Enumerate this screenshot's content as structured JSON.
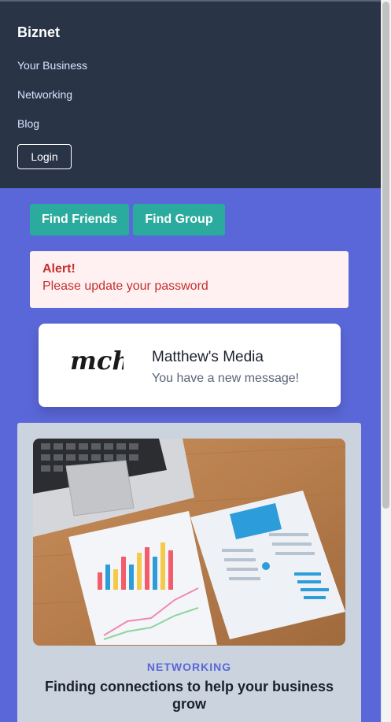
{
  "nav": {
    "brand": "Biznet",
    "links": [
      "Your Business",
      "Networking",
      "Blog"
    ],
    "login_label": "Login"
  },
  "actions": {
    "find_friends": "Find Friends",
    "find_group": "Find Group"
  },
  "alert": {
    "title": "Alert!",
    "message": "Please update your password"
  },
  "message_card": {
    "logo_text": "mch",
    "name": "Matthew's Media",
    "text": "You have a new message!"
  },
  "blog": {
    "category": "NETWORKING",
    "title": "Finding connections to help your business grow"
  },
  "colors": {
    "nav_bg": "#2a3447",
    "page_bg": "#5a67d8",
    "button": "#2bab9e",
    "alert_bg": "#fff1f1",
    "alert_text": "#c53030",
    "accent": "#5a67d8"
  }
}
